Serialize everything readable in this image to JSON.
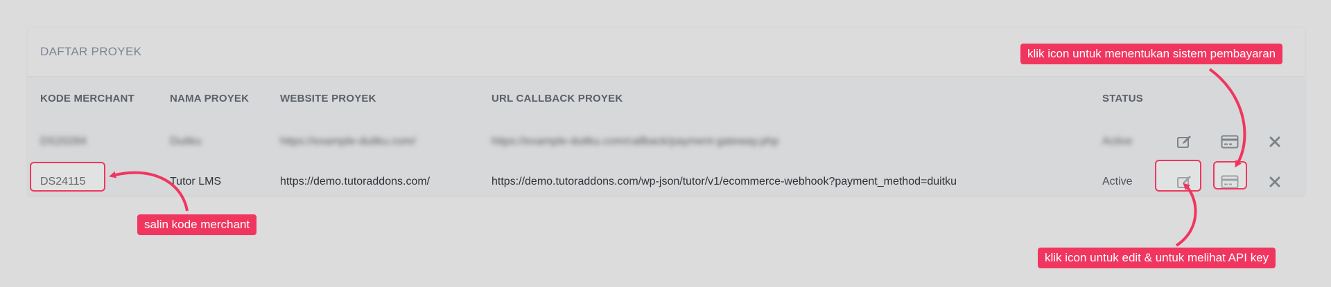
{
  "panel": {
    "title": "DAFTAR PROYEK"
  },
  "columns": {
    "merchant_code": "KODE MERCHANT",
    "project_name": "NAMA PROYEK",
    "website": "WEBSITE PROYEK",
    "callback_url": "URL CALLBACK PROYEK",
    "status": "STATUS"
  },
  "rows": [
    {
      "merchant_code": "DS20284",
      "project_name": "Duitku",
      "website": "https://example-duitku.com/",
      "callback_url": "https://example-duitku.com/callback/payment-gateway.php",
      "status": "Active"
    },
    {
      "merchant_code": "DS24115",
      "project_name": "Tutor LMS",
      "website": "https://demo.tutoraddons.com/",
      "callback_url": "https://demo.tutoraddons.com/wp-json/tutor/v1/ecommerce-webhook?payment_method=duitku",
      "status": "Active"
    }
  ],
  "annotations": {
    "copy_code": "salin kode merchant",
    "payment_system": "klik icon untuk menentukan sistem pembayaran",
    "edit_api": "klik icon untuk edit & untuk melihat API key"
  },
  "icons": {
    "edit": "edit-icon",
    "payment": "credit-card-icon",
    "delete": "close-icon"
  },
  "colors": {
    "accent": "#f0365f",
    "page_bg": "#dcdcdc",
    "card_bg": "#d7d8d9",
    "header_text": "#5b6169",
    "icon": "#7d838a"
  }
}
